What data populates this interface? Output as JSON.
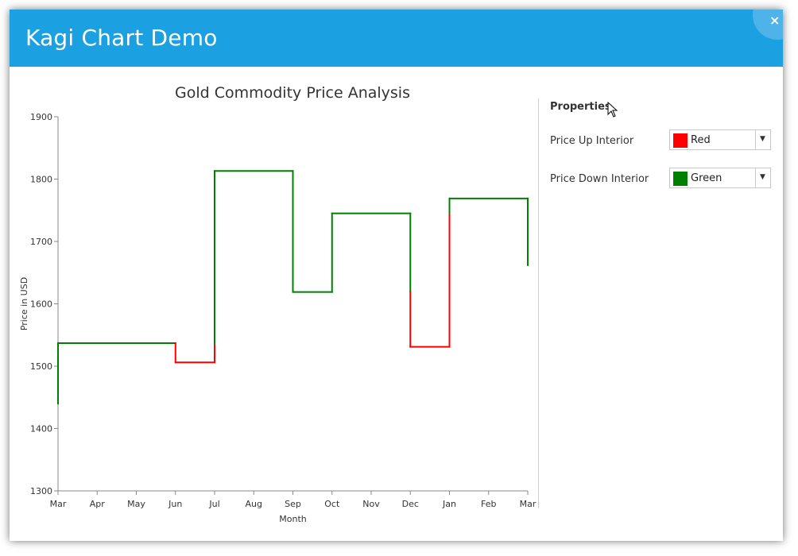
{
  "window": {
    "title": "Kagi Chart Demo",
    "close_glyph": "×"
  },
  "properties": {
    "title": "Properties",
    "up_label": "Price Up Interior",
    "up_value": "Red",
    "up_color": "#ff0000",
    "down_label": "Price Down Interior",
    "down_value": "Green",
    "down_color": "#008000",
    "dropdown_glyph": "▼"
  },
  "chart_data": {
    "type": "kagi",
    "title": "Gold Commodity Price Analysis",
    "xlabel": "Month",
    "ylabel": "Price in USD",
    "ylim": [
      1300,
      1900
    ],
    "yticks": [
      1300,
      1400,
      1500,
      1600,
      1700,
      1800,
      1900
    ],
    "categories": [
      "Mar",
      "Apr",
      "May",
      "Jun",
      "Jul",
      "Aug",
      "Sep",
      "Oct",
      "Nov",
      "Dec",
      "Jan",
      "Feb",
      "Mar"
    ],
    "up_color": "#ff0000",
    "down_color": "#008000",
    "lines": [
      {
        "kind": "v",
        "x": 0,
        "from": 1440,
        "to": 1537,
        "color": "#008000"
      },
      {
        "kind": "h",
        "from": 0,
        "to": 3,
        "y": 1537,
        "color": "#008000"
      },
      {
        "kind": "v",
        "x": 3,
        "from": 1537,
        "to": 1506,
        "color": "#ff0000"
      },
      {
        "kind": "h",
        "from": 3,
        "to": 4,
        "y": 1506,
        "color": "#ff0000"
      },
      {
        "kind": "v",
        "x": 4,
        "from": 1506,
        "to": 1537,
        "color": "#ff0000"
      },
      {
        "kind": "v",
        "x": 4,
        "from": 1537,
        "to": 1813,
        "color": "#008000"
      },
      {
        "kind": "h",
        "from": 4,
        "to": 6,
        "y": 1813,
        "color": "#008000"
      },
      {
        "kind": "v",
        "x": 6,
        "from": 1813,
        "to": 1619,
        "color": "#008000"
      },
      {
        "kind": "h",
        "from": 6,
        "to": 7,
        "y": 1619,
        "color": "#008000"
      },
      {
        "kind": "v",
        "x": 7,
        "from": 1619,
        "to": 1745,
        "color": "#008000"
      },
      {
        "kind": "h",
        "from": 7,
        "to": 9,
        "y": 1745,
        "color": "#008000"
      },
      {
        "kind": "v",
        "x": 9,
        "from": 1745,
        "to": 1619,
        "color": "#008000"
      },
      {
        "kind": "v",
        "x": 9,
        "from": 1619,
        "to": 1531,
        "color": "#ff0000"
      },
      {
        "kind": "h",
        "from": 9,
        "to": 10,
        "y": 1531,
        "color": "#ff0000"
      },
      {
        "kind": "v",
        "x": 10,
        "from": 1531,
        "to": 1745,
        "color": "#ff0000"
      },
      {
        "kind": "v",
        "x": 10,
        "from": 1745,
        "to": 1769,
        "color": "#008000"
      },
      {
        "kind": "h",
        "from": 10,
        "to": 12,
        "y": 1769,
        "color": "#008000"
      },
      {
        "kind": "v",
        "x": 12,
        "from": 1769,
        "to": 1662,
        "color": "#008000"
      }
    ]
  }
}
